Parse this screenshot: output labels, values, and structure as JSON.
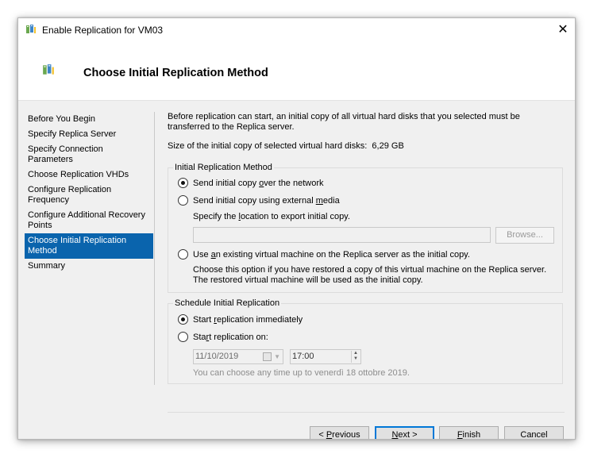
{
  "window": {
    "title": "Enable Replication for VM03",
    "close_glyph": "✕"
  },
  "header": {
    "title": "Choose Initial Replication Method"
  },
  "nav": {
    "items": [
      "Before You Begin",
      "Specify Replica Server",
      "Specify Connection Parameters",
      "Choose Replication VHDs",
      "Configure Replication Frequency",
      "Configure Additional Recovery Points",
      "Choose Initial Replication Method",
      "Summary"
    ],
    "active_index": 6
  },
  "content": {
    "description": "Before replication can start, an initial copy of all virtual hard disks that you selected must be transferred to the Replica server.",
    "size_label": "Size of the initial copy of selected virtual hard disks:",
    "size_value": "6,29 GB",
    "initial_group": {
      "title": "Initial Replication Method",
      "opt_network": {
        "pre": "Send initial copy ",
        "ul": "o",
        "post": "ver the network",
        "checked": true
      },
      "opt_external": {
        "pre": "Send initial copy using external ",
        "ul": "m",
        "post": "edia",
        "checked": false
      },
      "export_pre": "Specify the ",
      "export_ul": "l",
      "export_post": "ocation to export initial copy.",
      "path_value": "",
      "browse_label": "Browse...",
      "opt_existing": {
        "pre": "Use ",
        "ul": "a",
        "post": "n existing virtual machine on the Replica server as the initial copy.",
        "checked": false
      },
      "existing_help": "Choose this option if you have restored a copy of this virtual machine on the Replica server. The restored virtual machine will be used as the initial copy."
    },
    "schedule_group": {
      "title": "Schedule Initial Replication",
      "opt_immediate": {
        "pre": "Start ",
        "ul": "r",
        "post": "eplication immediately",
        "checked": true
      },
      "opt_on": {
        "pre": "Sta",
        "ul": "r",
        "post": "t replication on:",
        "checked": false
      },
      "date_value": "11/10/2019",
      "time_value": "17:00",
      "hint": "You can choose any time up to venerdì 18 ottobre 2019."
    }
  },
  "buttons": {
    "previous": {
      "pre": "< ",
      "ul": "P",
      "post": "revious"
    },
    "next": {
      "pre": "",
      "ul": "N",
      "post": "ext >"
    },
    "finish": {
      "pre": "",
      "ul": "F",
      "post": "inish"
    },
    "cancel": "Cancel"
  },
  "colors": {
    "accent": "#0a64ad",
    "dialog_bg": "#f0f0f0",
    "default_button_border": "#0078d7"
  }
}
